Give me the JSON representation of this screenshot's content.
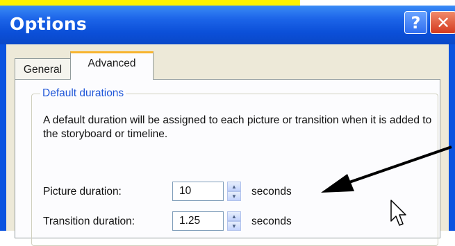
{
  "window": {
    "title": "Options",
    "help_label": "?",
    "close_label": "✕",
    "colors": {
      "titlebar": "#0b4fd8",
      "client": "#ede9d8",
      "close": "#d4391e",
      "group_title": "#1f56d8"
    }
  },
  "tabs": [
    {
      "label": "General",
      "selected": false
    },
    {
      "label": "Advanced",
      "selected": true
    }
  ],
  "group": {
    "title": "Default durations",
    "description": "A default duration will be assigned to each picture or transition when it is added to the storyboard or timeline."
  },
  "fields": {
    "picture": {
      "label": "Picture duration:",
      "value": "10",
      "units": "seconds"
    },
    "transition": {
      "label": "Transition duration:",
      "value": "1.25",
      "units": "seconds"
    }
  },
  "icons": {
    "spin_up": "▲",
    "spin_down": "▼"
  }
}
